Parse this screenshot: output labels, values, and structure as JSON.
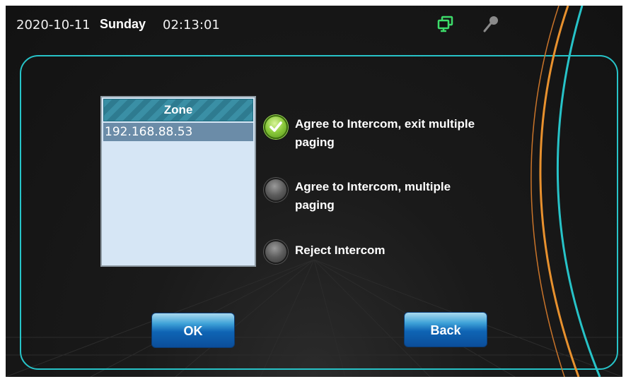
{
  "status_bar": {
    "date": "2020-10-11",
    "day": "Sunday",
    "time": "02:13:01",
    "icons": [
      "monitor-icon",
      "microphone-icon"
    ]
  },
  "zone_list": {
    "header": "Zone",
    "items": [
      "192.168.88.53"
    ],
    "selected_index": 0
  },
  "options": [
    {
      "line1": "Agree to Intercom, exit multiple",
      "line2": "paging",
      "selected": true
    },
    {
      "line1": "Agree to Intercom, multiple",
      "line2": "paging",
      "selected": false
    },
    {
      "line1": "Reject Intercom",
      "line2": "",
      "selected": false
    }
  ],
  "buttons": {
    "ok": "OK",
    "back": "Back"
  },
  "colors": {
    "frame": "#27c3c8",
    "arc_orange": "#e8912e",
    "arc_teal": "#27c3c8",
    "radio_selected": "#89c83a",
    "button_blue": "#0f64b4"
  }
}
